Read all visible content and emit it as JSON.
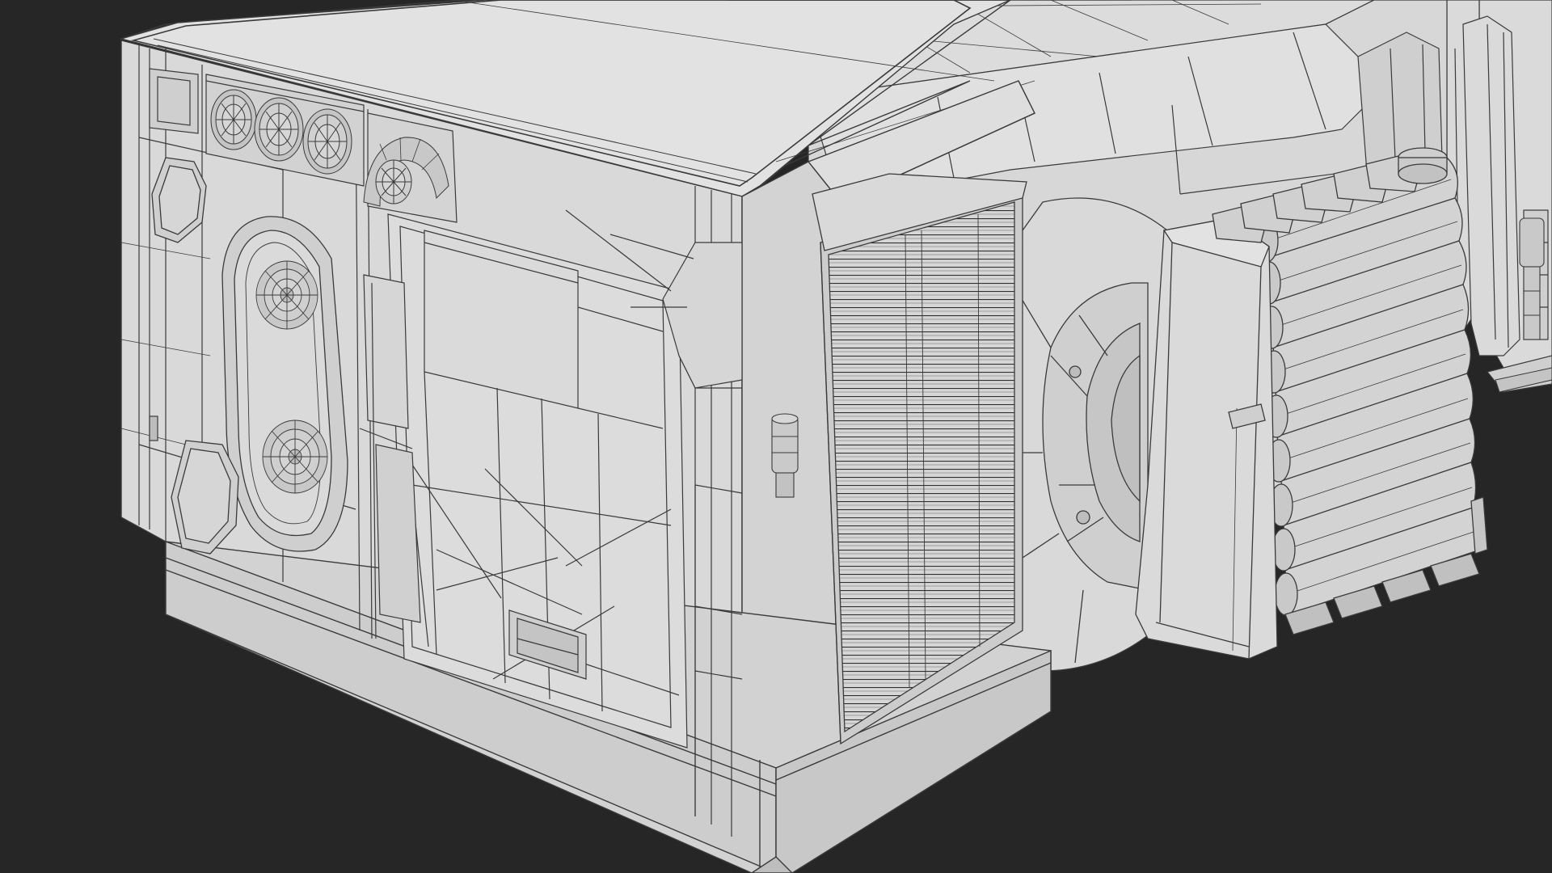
{
  "scene": {
    "render_style": "wireframe-on-shaded",
    "subject": "3d-model-generator-unit",
    "colors": {
      "background": "#262626",
      "surface": "#dcdcdc",
      "surface_shadow": "#c9c9c9",
      "surface_light": "#e6e6e6",
      "wire": "#3a3a3a",
      "wire_light": "#6a6a6a"
    }
  }
}
